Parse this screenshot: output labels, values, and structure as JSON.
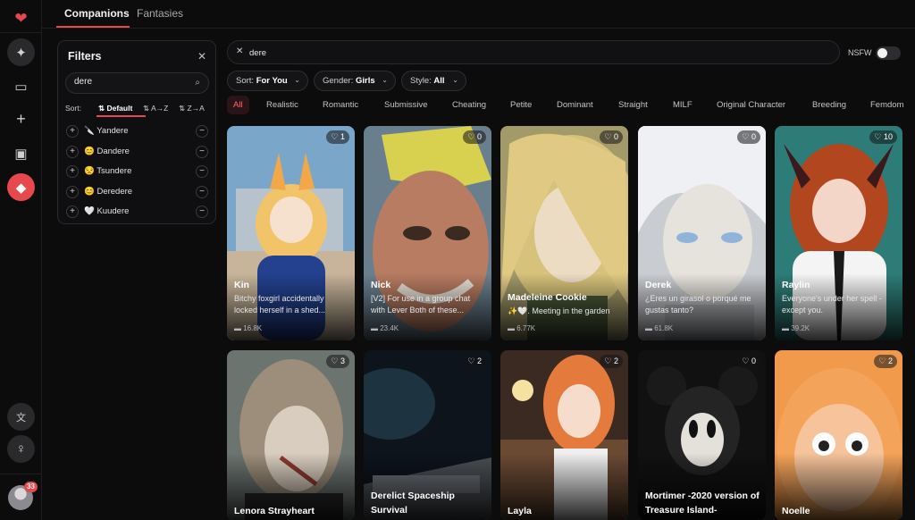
{
  "app": {
    "accent": "#e5484d"
  },
  "rail": {
    "icons": [
      "heart-pulse-icon",
      "sparkles-icon",
      "chat-icon",
      "plus-icon",
      "image-add-icon",
      "gem-icon",
      "translate-icon",
      "lightbulb-icon"
    ],
    "notification_count": "33"
  },
  "tabs": [
    {
      "label": "Companions",
      "active": true
    },
    {
      "label": "Fantasies",
      "active": false
    }
  ],
  "filters": {
    "title": "Filters",
    "search_value": "dere",
    "sort_label": "Sort:",
    "sort_options": [
      "Default",
      "A→Z",
      "Z→A"
    ],
    "sort_selected": "Default",
    "items": [
      "🔪 Yandere",
      "😊 Dandere",
      "😒 Tsundere",
      "😊 Deredere",
      "🤍 Kuudere"
    ]
  },
  "search": {
    "value": "dere",
    "nsfw_label": "NSFW",
    "nsfw_on": false
  },
  "dropdowns": [
    {
      "label": "Sort:",
      "value": "For You"
    },
    {
      "label": "Gender:",
      "value": "Girls"
    },
    {
      "label": "Style:",
      "value": "All"
    }
  ],
  "chips": [
    "All",
    "Realistic",
    "Romantic",
    "Submissive",
    "Cheating",
    "Petite",
    "Dominant",
    "Straight",
    "MILF",
    "Original Character",
    "Breeding",
    "Femdom"
  ],
  "cards": [
    {
      "likes": "1",
      "name": "Kin",
      "desc": "Bitchy foxgirl accidentally locked herself in a shed...",
      "count": "16.8K"
    },
    {
      "likes": "0",
      "name": "Nick",
      "desc": "[V2] For use in a group chat with Lever Both of these...",
      "count": "23.4K"
    },
    {
      "likes": "0",
      "name": "Madeleine Cookie",
      "desc": "✨🤍. Meeting in the garden",
      "count": "6.77K"
    },
    {
      "likes": "0",
      "name": "Derek",
      "desc": "¿Eres un girasol o porqué me gustas tanto?",
      "count": "61.8K"
    },
    {
      "likes": "10",
      "name": "Raylin",
      "desc": "Everyone's under her spell - except you.",
      "count": "39.2K"
    },
    {
      "likes": "3",
      "name": "Lenora Strayheart"
    },
    {
      "likes": "2",
      "name": "Derelict Spaceship Survival"
    },
    {
      "likes": "2",
      "name": "Layla"
    },
    {
      "likes": "0",
      "name": "Mortimer -2020 version of Treasure Island-"
    },
    {
      "likes": "2",
      "name": "Noelle"
    }
  ]
}
